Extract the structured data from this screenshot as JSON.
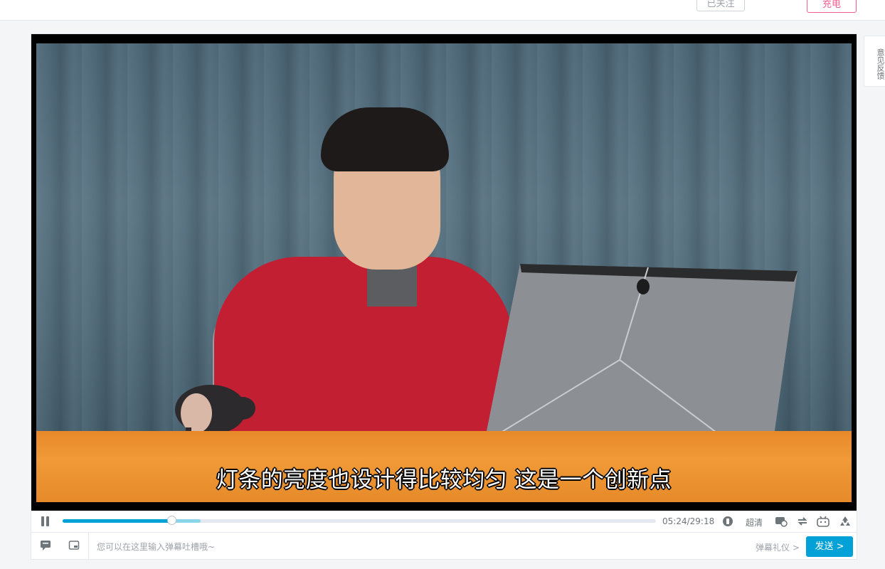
{
  "header": {
    "followed_label": "已关注",
    "charge_label": "充电"
  },
  "feedback": {
    "chars": [
      "意",
      "见",
      "反",
      "馈"
    ]
  },
  "video": {
    "subtitle": "灯条的亮度也设计得比较均匀 这是一个创新点"
  },
  "controls": {
    "progress_played_fraction": 0.185,
    "progress_buffered_fraction": 0.233,
    "time_current": "05:24",
    "time_separator": "/",
    "time_total": "29:18",
    "quality_label": "超清",
    "icons": [
      "pause-icon",
      "volume-icon",
      "danmaku-toggle-icon",
      "loop-icon",
      "bilibili-tv-icon",
      "radiation-icon"
    ]
  },
  "sendbar": {
    "input_placeholder": "您可以在这里输入弹幕吐槽哦~",
    "etiquette_label": "弹幕礼仪 >",
    "send_label": "发送 >"
  },
  "colors": {
    "accent": "#00a1d6",
    "pink": "#f25d8e",
    "buffered": "#8ad5ea"
  }
}
